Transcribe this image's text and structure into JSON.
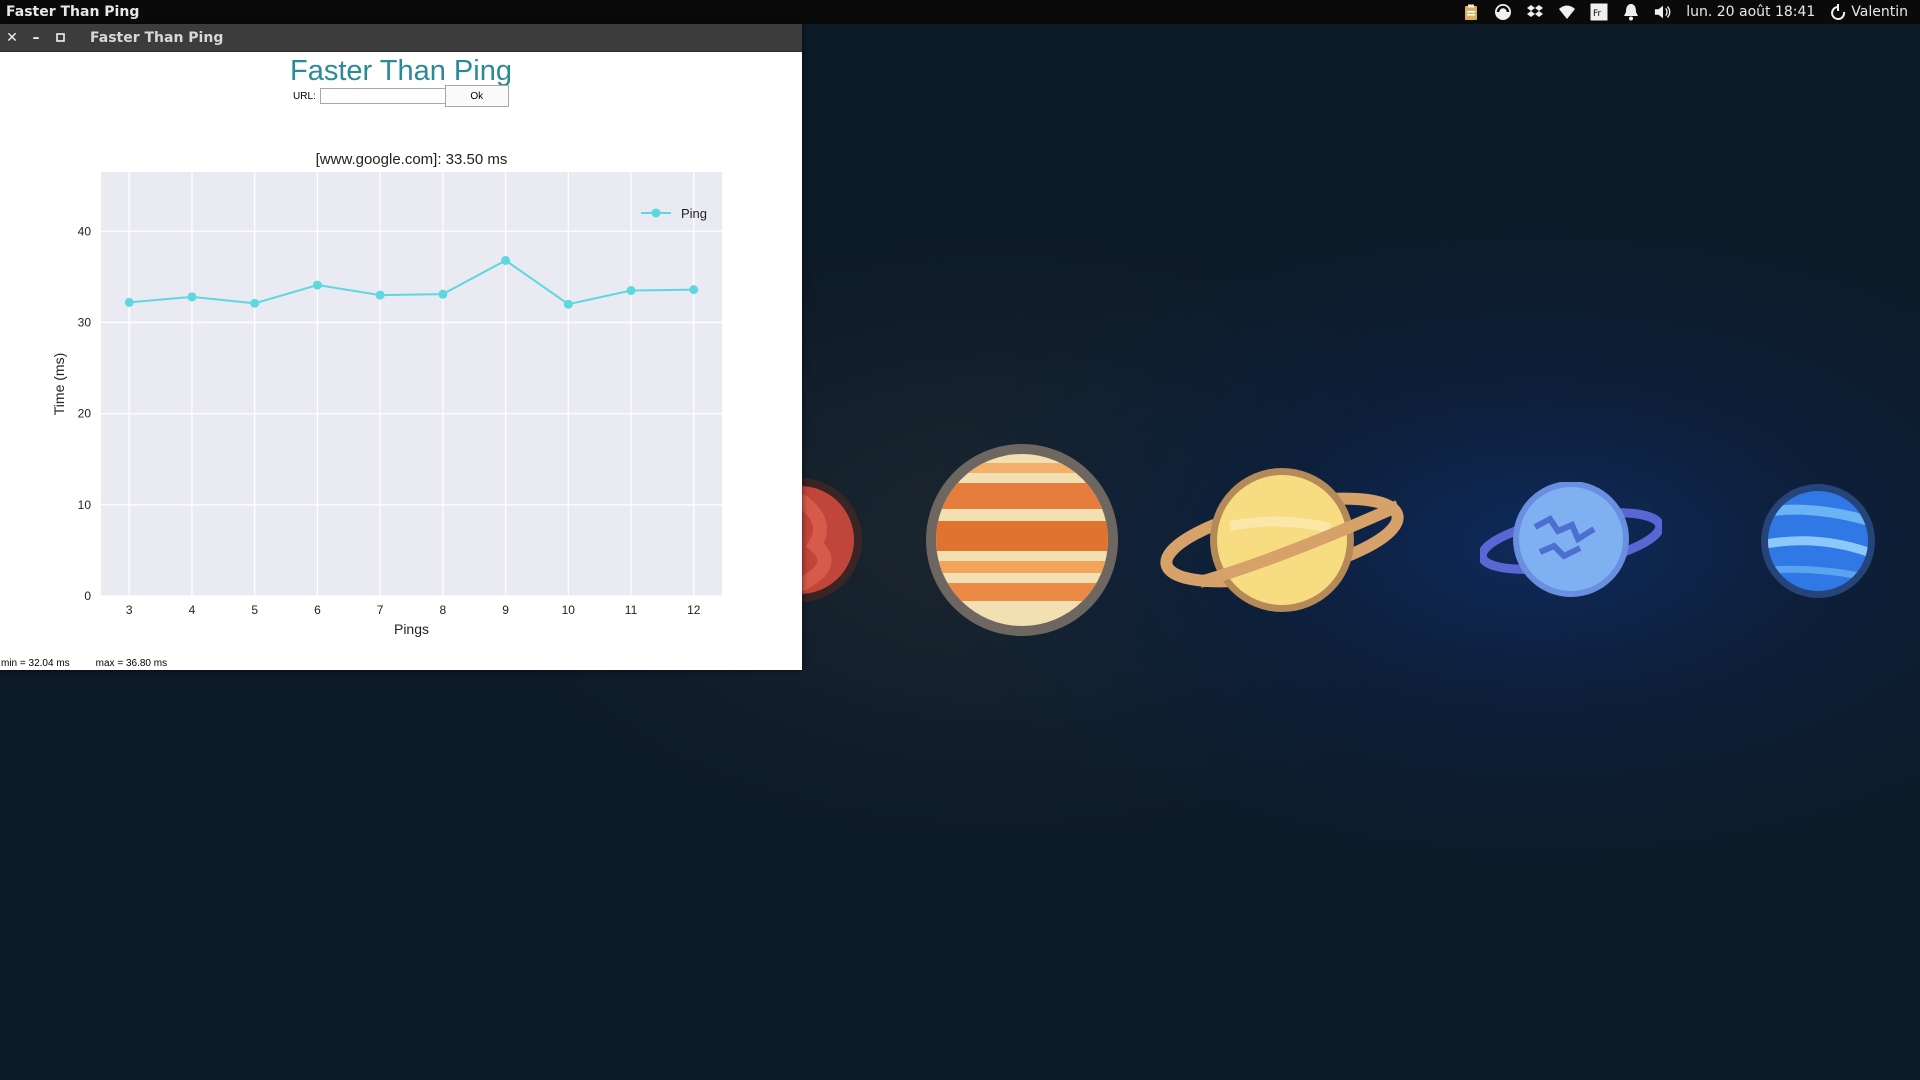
{
  "top_panel": {
    "active_app": "Faster Than Ping",
    "datetime": "lun. 20 août 18:41",
    "keyboard_layout": "Fr",
    "user": "Valentin",
    "icons": [
      "clipboard-icon",
      "sync-icon",
      "dropbox-icon",
      "wifi-icon",
      "keyboard-layout-icon",
      "notification-bell-icon",
      "volume-icon",
      "session-power-icon"
    ]
  },
  "window": {
    "title": "Faster Than Ping",
    "heading": "Faster Than Ping",
    "url_label": "URL:",
    "url_value": "",
    "ok_label": "Ok",
    "stats": {
      "min": "min = 32.04 ms",
      "max": "max = 36.80 ms"
    }
  },
  "chart_data": {
    "type": "line",
    "title": "[www.google.com]: 33.50 ms",
    "xlabel": "Pings",
    "ylabel": "Time (ms)",
    "x": [
      3,
      4,
      5,
      6,
      7,
      8,
      9,
      10,
      11,
      12
    ],
    "series": [
      {
        "name": "Ping",
        "values": [
          32.2,
          32.8,
          32.1,
          34.1,
          33.0,
          33.1,
          36.8,
          32.0,
          33.5,
          33.6
        ],
        "color": "#5fd7df"
      }
    ],
    "xlim": [
      2.55,
      12.45
    ],
    "ylim": [
      0,
      46.5
    ],
    "yticks": [
      0,
      10,
      20,
      30,
      40
    ],
    "xticks": [
      3,
      4,
      5,
      6,
      7,
      8,
      9,
      10,
      11,
      12
    ],
    "grid": true,
    "legend": "top-right",
    "plot_background": "#eaeaf2"
  }
}
